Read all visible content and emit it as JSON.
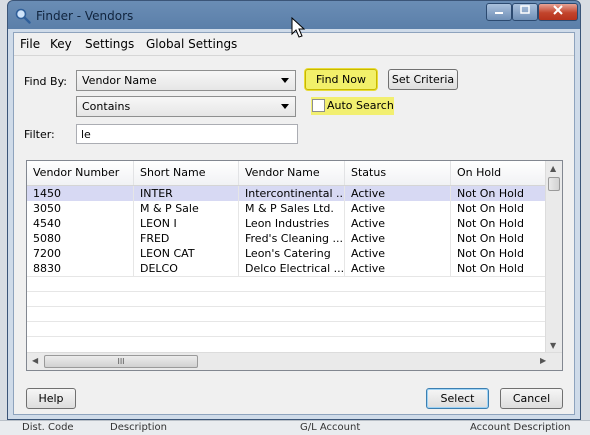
{
  "window": {
    "title": "Finder - Vendors"
  },
  "menu": [
    "File",
    "Key",
    "Settings",
    "Global Settings"
  ],
  "find": {
    "label": "Find By:",
    "field": "Vendor Name",
    "operator": "Contains",
    "find_now": "Find Now",
    "set_criteria": "Set Criteria",
    "auto_search": "Auto Search",
    "auto_search_checked": false
  },
  "filter": {
    "label": "Filter:",
    "value": "le"
  },
  "grid": {
    "columns": [
      "Vendor Number",
      "Short Name",
      "Vendor Name",
      "Status",
      "On Hold"
    ],
    "rows": [
      [
        "1450",
        "INTER",
        "Intercontinental ...",
        "Active",
        "Not On Hold"
      ],
      [
        "3050",
        "M & P Sale",
        "M & P Sales Ltd.",
        "Active",
        "Not On Hold"
      ],
      [
        "4540",
        "LEON I",
        "Leon Industries",
        "Active",
        "Not On Hold"
      ],
      [
        "5080",
        "FRED",
        "Fred's Cleaning ...",
        "Active",
        "Not On Hold"
      ],
      [
        "7200",
        "LEON CAT",
        "Leon's Catering",
        "Active",
        "Not On Hold"
      ],
      [
        "8830",
        "DELCO",
        "Delco Electrical ...",
        "Active",
        "Not On Hold"
      ]
    ],
    "selected_row": 0
  },
  "buttons": {
    "help": "Help",
    "select": "Select",
    "cancel": "Cancel"
  },
  "background": {
    "col1": "Dist. Code",
    "col2": "Description",
    "col3": "G/L Account",
    "col4": "Account Description"
  },
  "colors": {
    "highlight": "#f2f06a",
    "selection": "#d7d9f3",
    "titlebar": "#5b7fa9"
  }
}
